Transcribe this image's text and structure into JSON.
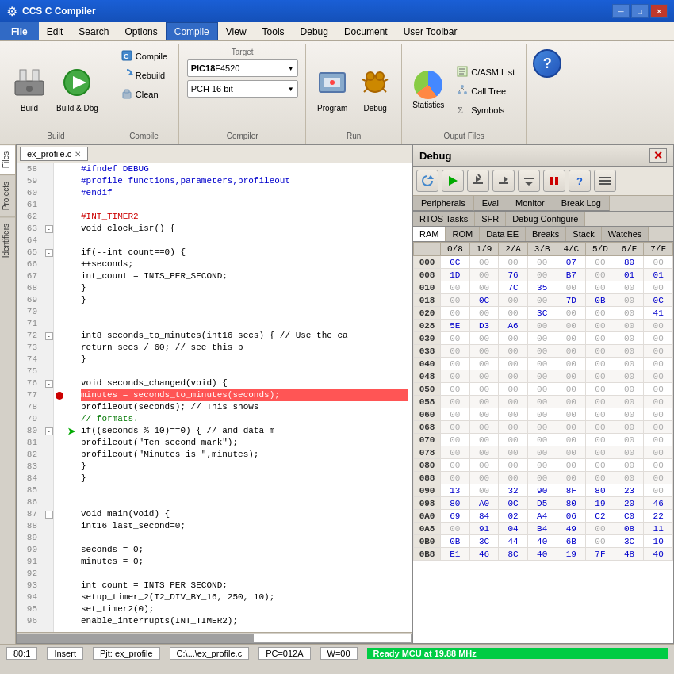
{
  "titleBar": {
    "title": "CCS C Compiler",
    "icon": "⚙",
    "minimize": "─",
    "maximize": "□",
    "close": "✕"
  },
  "menuBar": {
    "items": [
      "File",
      "Edit",
      "Search",
      "Options",
      "Compile",
      "View",
      "Tools",
      "Debug",
      "Document",
      "User Toolbar"
    ]
  },
  "toolbar": {
    "buildLabel": "Build",
    "buildAndDbgLabel": "Build & Dbg",
    "compileLabel": "Compile",
    "rebuildLabel": "Rebuild",
    "cleanLabel": "Clean",
    "programLabel": "Program",
    "debugLabel": "Debug",
    "statisticsLabel": "Statistics",
    "groupLabels": [
      "Build",
      "Compile",
      "Compiler",
      "Run",
      "Ouput Files"
    ],
    "targetLabel": "Target",
    "targetValue": "PIC18F4520",
    "targetBits": "PCH 16 bit",
    "compileSubItems": [
      "Compile",
      "Rebuild",
      "Clean"
    ],
    "outputItems": [
      "C/ASM List",
      "Call Tree",
      "Symbols"
    ]
  },
  "editor": {
    "filename": "ex_profile.c",
    "lines": [
      {
        "num": 58,
        "fold": null,
        "bp": false,
        "dbg": false,
        "content": "#ifndef DEBUG",
        "type": "preprocessor"
      },
      {
        "num": 59,
        "fold": null,
        "bp": false,
        "dbg": false,
        "content": "  #profile functions,parameters,profileout",
        "type": "preprocessor"
      },
      {
        "num": 60,
        "fold": null,
        "bp": false,
        "dbg": false,
        "content": "#endif",
        "type": "preprocessor"
      },
      {
        "num": 61,
        "fold": null,
        "bp": false,
        "dbg": false,
        "content": "",
        "type": "normal"
      },
      {
        "num": 62,
        "fold": null,
        "bp": false,
        "dbg": false,
        "content": "#INT_TIMER2",
        "type": "kw-red"
      },
      {
        "num": 63,
        "fold": "-",
        "bp": false,
        "dbg": false,
        "content": "void clock_isr() {",
        "type": "normal"
      },
      {
        "num": 64,
        "fold": null,
        "bp": false,
        "dbg": false,
        "content": "",
        "type": "normal"
      },
      {
        "num": 65,
        "fold": "-",
        "bp": false,
        "dbg": false,
        "content": "   if(--int_count==0) {",
        "type": "normal"
      },
      {
        "num": 66,
        "fold": null,
        "bp": false,
        "dbg": false,
        "content": "      ++seconds;",
        "type": "normal"
      },
      {
        "num": 67,
        "fold": null,
        "bp": false,
        "dbg": false,
        "content": "      int_count = INTS_PER_SECOND;",
        "type": "normal"
      },
      {
        "num": 68,
        "fold": null,
        "bp": false,
        "dbg": false,
        "content": "   }",
        "type": "normal"
      },
      {
        "num": 69,
        "fold": null,
        "bp": false,
        "dbg": false,
        "content": "}",
        "type": "normal"
      },
      {
        "num": 70,
        "fold": null,
        "bp": false,
        "dbg": false,
        "content": "",
        "type": "normal"
      },
      {
        "num": 71,
        "fold": null,
        "bp": false,
        "dbg": false,
        "content": "",
        "type": "normal"
      },
      {
        "num": 72,
        "fold": "-",
        "bp": false,
        "dbg": false,
        "content": "int8 seconds_to_minutes(int16 secs) {   // Use the ca",
        "type": "normal"
      },
      {
        "num": 73,
        "fold": null,
        "bp": false,
        "dbg": false,
        "content": "   return secs / 60;                    // see this p",
        "type": "normal"
      },
      {
        "num": 74,
        "fold": null,
        "bp": false,
        "dbg": false,
        "content": "}",
        "type": "normal"
      },
      {
        "num": 75,
        "fold": null,
        "bp": false,
        "dbg": false,
        "content": "",
        "type": "normal"
      },
      {
        "num": 76,
        "fold": "-",
        "bp": false,
        "dbg": false,
        "content": "void seconds_changed(void) {",
        "type": "normal"
      },
      {
        "num": 77,
        "fold": null,
        "bp": true,
        "dbg": false,
        "content": "   minutes = seconds_to_minutes(seconds);",
        "type": "highlighted"
      },
      {
        "num": 78,
        "fold": null,
        "bp": false,
        "dbg": false,
        "content": "   profileout(seconds);         // This shows",
        "type": "normal"
      },
      {
        "num": 79,
        "fold": null,
        "bp": false,
        "dbg": false,
        "content": "                                // formats.",
        "type": "comment"
      },
      {
        "num": 80,
        "fold": "-",
        "bp": false,
        "dbg": true,
        "content": "   if((seconds % 10)==0) {      // and data m",
        "type": "normal"
      },
      {
        "num": 81,
        "fold": null,
        "bp": false,
        "dbg": false,
        "content": "      profileout(\"Ten second mark\");",
        "type": "normal"
      },
      {
        "num": 82,
        "fold": null,
        "bp": false,
        "dbg": false,
        "content": "      profileout(\"Minutes is \",minutes);",
        "type": "normal"
      },
      {
        "num": 83,
        "fold": null,
        "bp": false,
        "dbg": false,
        "content": "   }",
        "type": "normal"
      },
      {
        "num": 84,
        "fold": null,
        "bp": false,
        "dbg": false,
        "content": "}",
        "type": "normal"
      },
      {
        "num": 85,
        "fold": null,
        "bp": false,
        "dbg": false,
        "content": "",
        "type": "normal"
      },
      {
        "num": 86,
        "fold": null,
        "bp": false,
        "dbg": false,
        "content": "",
        "type": "normal"
      },
      {
        "num": 87,
        "fold": "-",
        "bp": false,
        "dbg": false,
        "content": "void main(void) {",
        "type": "normal"
      },
      {
        "num": 88,
        "fold": null,
        "bp": false,
        "dbg": false,
        "content": "   int16 last_second=0;",
        "type": "normal"
      },
      {
        "num": 89,
        "fold": null,
        "bp": false,
        "dbg": false,
        "content": "",
        "type": "normal"
      },
      {
        "num": 90,
        "fold": null,
        "bp": false,
        "dbg": false,
        "content": "   seconds = 0;",
        "type": "normal"
      },
      {
        "num": 91,
        "fold": null,
        "bp": false,
        "dbg": false,
        "content": "   minutes = 0;",
        "type": "normal"
      },
      {
        "num": 92,
        "fold": null,
        "bp": false,
        "dbg": false,
        "content": "",
        "type": "normal"
      },
      {
        "num": 93,
        "fold": null,
        "bp": false,
        "dbg": false,
        "content": "   int_count = INTS_PER_SECOND;",
        "type": "normal"
      },
      {
        "num": 94,
        "fold": null,
        "bp": false,
        "dbg": false,
        "content": "   setup_timer_2(T2_DIV_BY_16, 250, 10);",
        "type": "normal"
      },
      {
        "num": 95,
        "fold": null,
        "bp": false,
        "dbg": false,
        "content": "   set_timer2(0);",
        "type": "normal"
      },
      {
        "num": 96,
        "fold": null,
        "bp": false,
        "dbg": false,
        "content": "   enable_interrupts(INT_TIMER2);",
        "type": "normal"
      }
    ]
  },
  "statusBar": {
    "position": "80:1",
    "mode": "Insert",
    "project": "Pjt: ex_profile",
    "path": "C:\\...\\ex_profile.c",
    "pc": "PC=012A",
    "w": "W=00",
    "status": "Ready MCU at 19.88 MHz"
  },
  "debugPanel": {
    "title": "Debug",
    "tabs1": [
      "Peripherals",
      "Eval",
      "Monitor",
      "Break Log"
    ],
    "tabs2": [
      "RTOS Tasks",
      "SFR",
      "Debug Configure"
    ],
    "tabs3": [
      "RAM",
      "ROM",
      "Data EE",
      "Breaks",
      "Stack",
      "Watches"
    ],
    "memHeaders": [
      "0/8",
      "1/9",
      "2/A",
      "3/B",
      "4/C",
      "5/D",
      "6/E",
      "7/F"
    ],
    "memRows": [
      {
        "addr": "000",
        "vals": [
          "0C",
          "00",
          "00",
          "00",
          "07",
          "00",
          "80"
        ]
      },
      {
        "addr": "008",
        "vals": [
          "1D",
          "00",
          "76",
          "00",
          "B7",
          "00",
          "01",
          "01"
        ]
      },
      {
        "addr": "010",
        "vals": [
          "00",
          "00",
          "7C",
          "35",
          "00",
          "00",
          "00",
          "00"
        ]
      },
      {
        "addr": "018",
        "vals": [
          "00",
          "0C",
          "00",
          "00",
          "7D",
          "0B",
          "00",
          "0C"
        ]
      },
      {
        "addr": "020",
        "vals": [
          "00",
          "00",
          "00",
          "3C",
          "00",
          "00",
          "00",
          "41"
        ]
      },
      {
        "addr": "028",
        "vals": [
          "5E",
          "D3",
          "A6",
          "00",
          "00",
          "00",
          "00",
          "00"
        ]
      },
      {
        "addr": "030",
        "vals": [
          "00",
          "00",
          "00",
          "00",
          "00",
          "00",
          "00",
          "00"
        ]
      },
      {
        "addr": "038",
        "vals": [
          "00",
          "00",
          "00",
          "00",
          "00",
          "00",
          "00",
          "00"
        ]
      },
      {
        "addr": "040",
        "vals": [
          "00",
          "00",
          "00",
          "00",
          "00",
          "00",
          "00",
          "00"
        ]
      },
      {
        "addr": "048",
        "vals": [
          "00",
          "00",
          "00",
          "00",
          "00",
          "00",
          "00",
          "00"
        ]
      },
      {
        "addr": "050",
        "vals": [
          "00",
          "00",
          "00",
          "00",
          "00",
          "00",
          "00",
          "00"
        ]
      },
      {
        "addr": "058",
        "vals": [
          "00",
          "00",
          "00",
          "00",
          "00",
          "00",
          "00",
          "00"
        ]
      },
      {
        "addr": "060",
        "vals": [
          "00",
          "00",
          "00",
          "00",
          "00",
          "00",
          "00",
          "00"
        ]
      },
      {
        "addr": "068",
        "vals": [
          "00",
          "00",
          "00",
          "00",
          "00",
          "00",
          "00",
          "00"
        ]
      },
      {
        "addr": "070",
        "vals": [
          "00",
          "00",
          "00",
          "00",
          "00",
          "00",
          "00",
          "00"
        ]
      },
      {
        "addr": "078",
        "vals": [
          "00",
          "00",
          "00",
          "00",
          "00",
          "00",
          "00",
          "00"
        ]
      },
      {
        "addr": "080",
        "vals": [
          "00",
          "00",
          "00",
          "00",
          "00",
          "00",
          "00",
          "00"
        ]
      },
      {
        "addr": "088",
        "vals": [
          "00",
          "00",
          "00",
          "00",
          "00",
          "00",
          "00",
          "00"
        ]
      },
      {
        "addr": "090",
        "vals": [
          "13",
          "00",
          "32",
          "90",
          "8F",
          "80",
          "23",
          "00"
        ]
      },
      {
        "addr": "098",
        "vals": [
          "80",
          "A0",
          "0C",
          "D5",
          "80",
          "19",
          "20",
          "46"
        ]
      },
      {
        "addr": "0A0",
        "vals": [
          "69",
          "84",
          "02",
          "A4",
          "06",
          "C2",
          "C0",
          "22"
        ]
      },
      {
        "addr": "0A8",
        "vals": [
          "00",
          "91",
          "04",
          "B4",
          "49",
          "00",
          "08",
          "11"
        ]
      },
      {
        "addr": "0B0",
        "vals": [
          "0B",
          "3C",
          "44",
          "40",
          "6B",
          "00",
          "3C",
          "10"
        ]
      },
      {
        "addr": "0B8",
        "vals": [
          "E1",
          "46",
          "8C",
          "40",
          "19",
          "7F",
          "48",
          "40"
        ]
      }
    ]
  }
}
